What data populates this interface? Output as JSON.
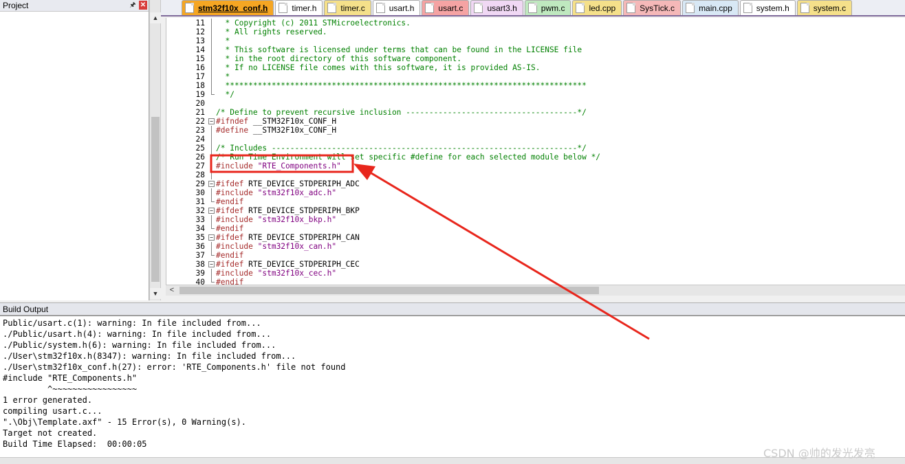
{
  "project_panel": {
    "title": "Project"
  },
  "tabs": [
    {
      "label": "stm32f10x_conf.h",
      "color": "#f5a623",
      "active": true
    },
    {
      "label": "timer.h",
      "color": "#ffffff",
      "active": false
    },
    {
      "label": "timer.c",
      "color": "#f5e08a",
      "active": false
    },
    {
      "label": "usart.h",
      "color": "#ffffff",
      "active": false
    },
    {
      "label": "usart.c",
      "color": "#f5a3a3",
      "active": false
    },
    {
      "label": "usart3.h",
      "color": "#f0d8f4",
      "active": false
    },
    {
      "label": "pwm.c",
      "color": "#bfe8bf",
      "active": false
    },
    {
      "label": "led.cpp",
      "color": "#f5e08a",
      "active": false
    },
    {
      "label": "SysTick.c",
      "color": "#f5b8b8",
      "active": false
    },
    {
      "label": "main.cpp",
      "color": "#d8e8f5",
      "active": false
    },
    {
      "label": "system.h",
      "color": "#ffffff",
      "active": false
    },
    {
      "label": "system.c",
      "color": "#f5e08a",
      "active": false
    }
  ],
  "code_lines": [
    {
      "n": "11",
      "fold": "line",
      "t": "  * Copyright (c) 2011 STMicroelectronics.",
      "c": "comment"
    },
    {
      "n": "12",
      "fold": "line",
      "t": "  * All rights reserved.",
      "c": "comment"
    },
    {
      "n": "13",
      "fold": "line",
      "t": "  *",
      "c": "comment"
    },
    {
      "n": "14",
      "fold": "line",
      "t": "  * This software is licensed under terms that can be found in the LICENSE file",
      "c": "comment"
    },
    {
      "n": "15",
      "fold": "line",
      "t": "  * in the root directory of this software component.",
      "c": "comment"
    },
    {
      "n": "16",
      "fold": "line",
      "t": "  * If no LICENSE file comes with this software, it is provided AS-IS.",
      "c": "comment"
    },
    {
      "n": "17",
      "fold": "line",
      "t": "  *",
      "c": "comment"
    },
    {
      "n": "18",
      "fold": "line",
      "t": "  ******************************************************************************",
      "c": "comment"
    },
    {
      "n": "19",
      "fold": "end",
      "t": "  */",
      "c": "comment"
    },
    {
      "n": "20",
      "fold": "",
      "t": "",
      "c": "plain"
    },
    {
      "n": "21",
      "fold": "",
      "t": "/* Define to prevent recursive inclusion -------------------------------------*/",
      "c": "comment"
    },
    {
      "n": "22",
      "fold": "box",
      "t": "#ifndef __STM32F10x_CONF_H",
      "c": "pre"
    },
    {
      "n": "23",
      "fold": "line",
      "t": "#define __STM32F10x_CONF_H",
      "c": "pre"
    },
    {
      "n": "24",
      "fold": "line",
      "t": "",
      "c": "plain"
    },
    {
      "n": "25",
      "fold": "line",
      "t": "/* Includes ------------------------------------------------------------------*/",
      "c": "comment"
    },
    {
      "n": "26",
      "fold": "line",
      "t": "/* Run Time Environment will set specific #define for each selected module below */",
      "c": "comment"
    },
    {
      "n": "27",
      "fold": "line",
      "t": "#include \"RTE_Components.h\"",
      "c": "include"
    },
    {
      "n": "28",
      "fold": "line",
      "t": "",
      "c": "plain"
    },
    {
      "n": "29",
      "fold": "box",
      "t": "#ifdef RTE_DEVICE_STDPERIPH_ADC",
      "c": "pre"
    },
    {
      "n": "30",
      "fold": "line",
      "t": "#include \"stm32f10x_adc.h\"",
      "c": "include"
    },
    {
      "n": "31",
      "fold": "end",
      "t": "#endif",
      "c": "pre"
    },
    {
      "n": "32",
      "fold": "box",
      "t": "#ifdef RTE_DEVICE_STDPERIPH_BKP",
      "c": "pre"
    },
    {
      "n": "33",
      "fold": "line",
      "t": "#include \"stm32f10x_bkp.h\"",
      "c": "include"
    },
    {
      "n": "34",
      "fold": "end",
      "t": "#endif",
      "c": "pre"
    },
    {
      "n": "35",
      "fold": "box",
      "t": "#ifdef RTE_DEVICE_STDPERIPH_CAN",
      "c": "pre"
    },
    {
      "n": "36",
      "fold": "line",
      "t": "#include \"stm32f10x_can.h\"",
      "c": "include"
    },
    {
      "n": "37",
      "fold": "end",
      "t": "#endif",
      "c": "pre"
    },
    {
      "n": "38",
      "fold": "box",
      "t": "#ifdef RTE_DEVICE_STDPERIPH_CEC",
      "c": "pre"
    },
    {
      "n": "39",
      "fold": "line",
      "t": "#include \"stm32f10x_cec.h\"",
      "c": "include"
    },
    {
      "n": "40",
      "fold": "end",
      "t": "#endif",
      "c": "pre"
    }
  ],
  "build_output": {
    "title": "Build Output",
    "lines": [
      "Public/usart.c(1): warning: In file included from...",
      "./Public/usart.h(4): warning: In file included from...",
      "./Public/system.h(6): warning: In file included from...",
      "./User\\stm32f10x.h(8347): warning: In file included from...",
      "./User\\stm32f10x_conf.h(27): error: 'RTE_Components.h' file not found",
      "#include \"RTE_Components.h\"",
      "         ^~~~~~~~~~~~~~~~~~",
      "1 error generated.",
      "compiling usart.c...",
      "\".\\Obj\\Template.axf\" - 15 Error(s), 0 Warning(s).",
      "Target not created.",
      "Build Time Elapsed:  00:00:05"
    ]
  },
  "watermark": "CSDN @帅的发光发亮",
  "colors": {
    "annotation_red": "#e8261c",
    "comment_green": "#008000",
    "preprocessor": "#a52a2a",
    "string_purple": "#800080"
  }
}
